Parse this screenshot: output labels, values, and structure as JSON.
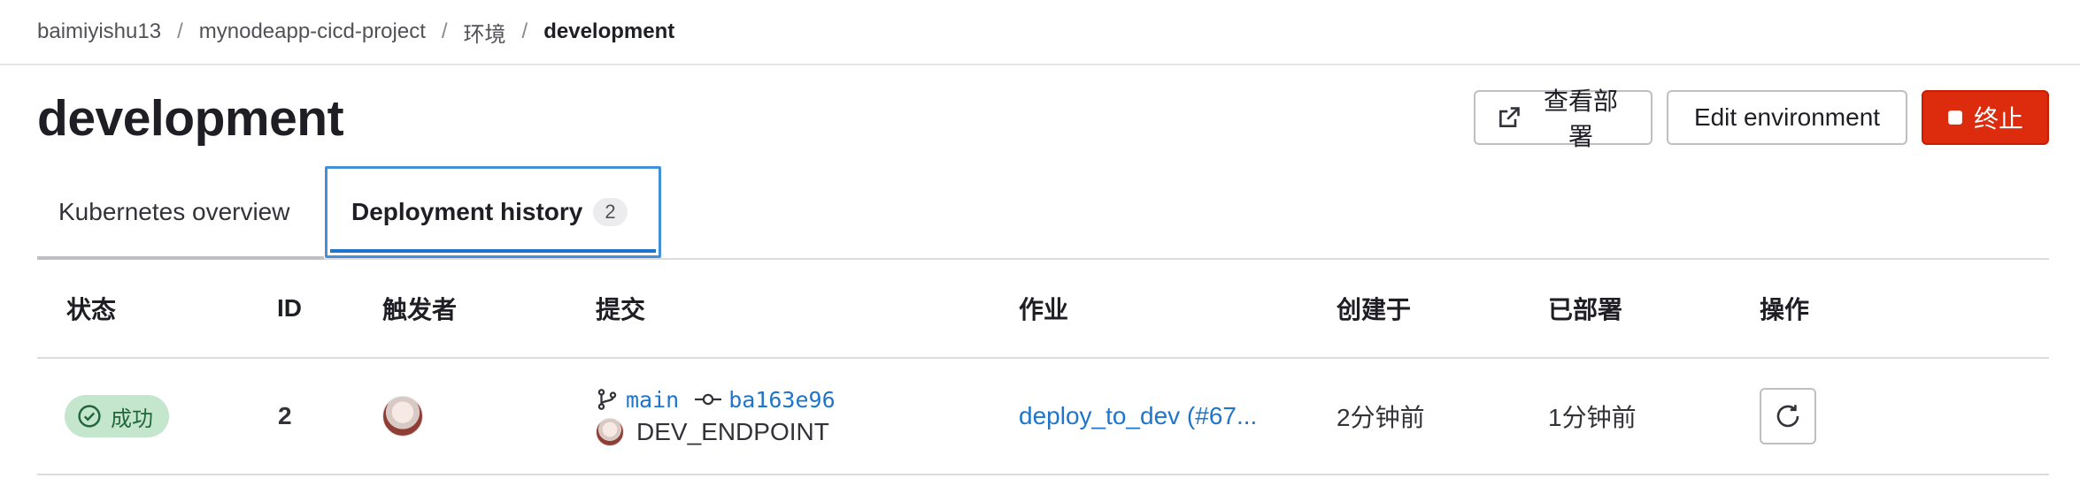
{
  "breadcrumb": {
    "items": [
      "baimiyishu13",
      "mynodeapp-cicd-project",
      "环境"
    ],
    "separator": "/",
    "current": "development"
  },
  "page": {
    "title": "development"
  },
  "actions": {
    "view_deployment": "查看部署",
    "edit_environment": "Edit environment",
    "stop": "终止"
  },
  "tabs": {
    "kubernetes": {
      "label": "Kubernetes overview"
    },
    "history": {
      "label": "Deployment history",
      "count": "2"
    }
  },
  "table": {
    "headers": {
      "status": "状态",
      "id": "ID",
      "triggerer": "触发者",
      "commit": "提交",
      "job": "作业",
      "created": "创建于",
      "deployed": "已部署",
      "actions": "操作"
    },
    "rows": [
      {
        "status": "成功",
        "id": "2",
        "ref": "main",
        "sha": "ba163e96",
        "commit_title": "DEV_ENDPOINT",
        "job": "deploy_to_dev (#67...",
        "created": "2分钟前",
        "deployed": "1分钟前"
      }
    ]
  },
  "icons": {
    "external_link": "external-link-icon",
    "stop": "stop-icon",
    "check": "check-circle-icon",
    "branch": "branch-icon",
    "commit": "commit-icon",
    "retry": "retry-icon"
  },
  "colors": {
    "danger": "#dd2b0e",
    "link": "#1f75cb",
    "success_bg": "#c3e6cd",
    "success_text": "#24663b",
    "focus_ring": "#428fdc"
  }
}
